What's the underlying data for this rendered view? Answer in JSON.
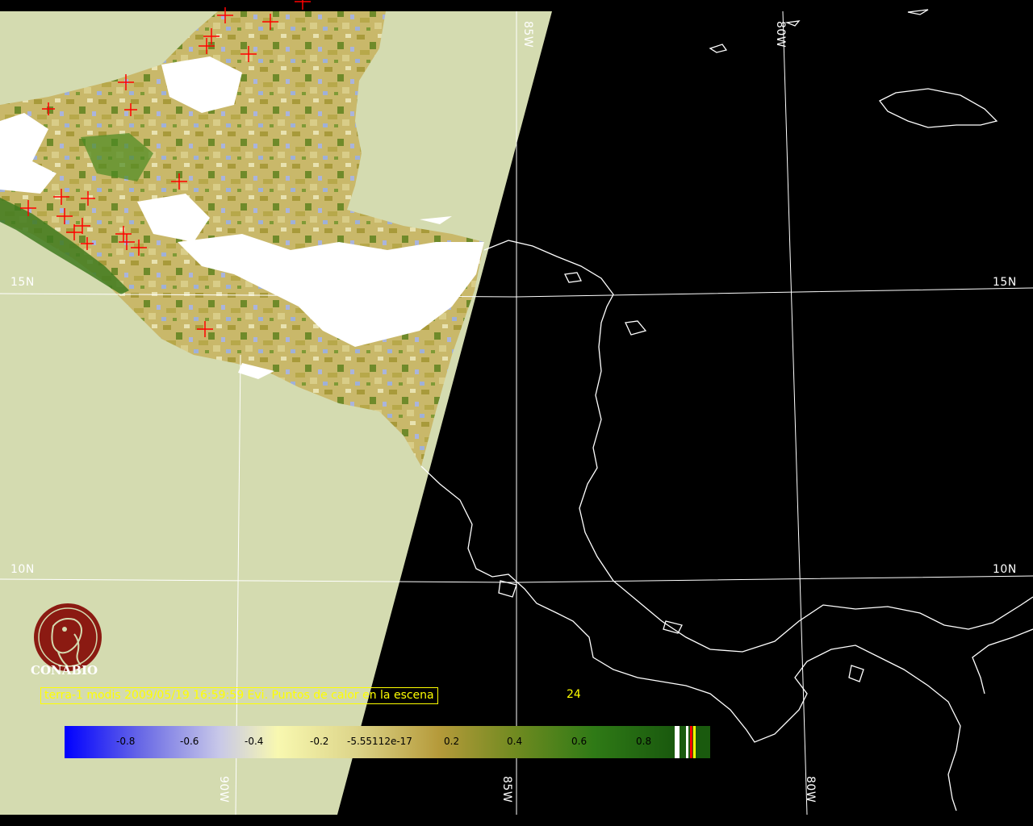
{
  "map": {
    "grid_labels": {
      "lat_15n_left": "15N",
      "lat_15n_right": "15N",
      "lat_10n_left": "10N",
      "lat_10n_right": "10N",
      "lon_85w_top": "85W",
      "lon_80w_top": "80W",
      "lon_90w_bottom": "90W",
      "lon_85w_bottom": "85W",
      "lon_80w_bottom": "80W"
    },
    "colors": {
      "background": "#000000",
      "swath_fill": "#d4dbb0",
      "grid": "#ffffff",
      "coastline": "#ffffff",
      "fire_marker": "#ff0000",
      "caption": "#ffff00"
    },
    "fire_marker_icon": "red-cross-icon"
  },
  "caption": {
    "text": "terra-1 modis 2009/05/19 16:59:59 Evi. Puntos de calor en la escena",
    "count": "24"
  },
  "colorbar": {
    "ticks": [
      "-0.8",
      "-0.6",
      "-0.4",
      "-0.2",
      "-5.55112e-17",
      "0.2",
      "0.4",
      "0.6",
      "0.8"
    ],
    "range": [
      -1,
      1
    ]
  },
  "logo": {
    "text": "CONABIO",
    "icon": "conabio-macaw-logo-icon",
    "color": "#8b1a12"
  }
}
